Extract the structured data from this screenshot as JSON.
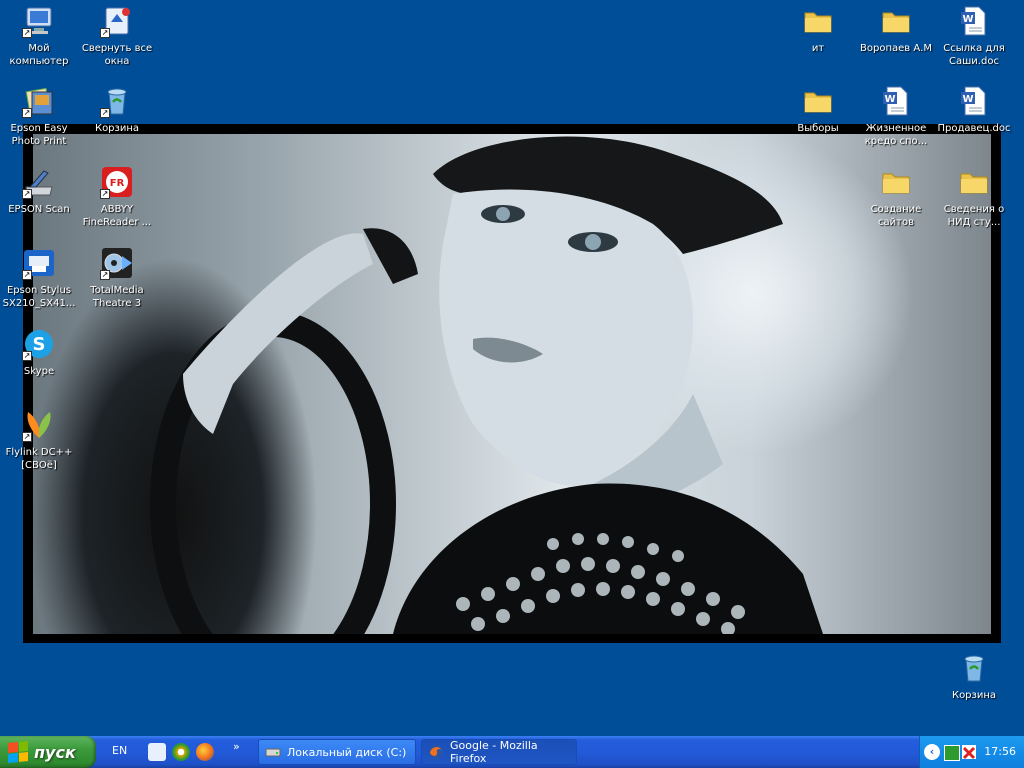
{
  "desktop_icons_left": [
    {
      "label": "Мой компьютер",
      "icon": "my-computer-icon"
    },
    {
      "label": "Свернуть все окна",
      "icon": "show-desktop-icon"
    },
    {
      "label": "Epson Easy Photo Print",
      "icon": "epson-easy-photo-print-icon"
    },
    {
      "label": "Корзина",
      "icon": "recycle-bin-icon"
    },
    {
      "label": "EPSON Scan",
      "icon": "epson-scan-icon"
    },
    {
      "label": "ABBYY FineReader ...",
      "icon": "abbyy-finereader-icon"
    },
    {
      "label": "Epson Stylus SX210_SX41...",
      "icon": "epson-stylus-icon"
    },
    {
      "label": "TotalMedia Theatre 3",
      "icon": "totalmedia-theatre-icon"
    },
    {
      "label": "Skype",
      "icon": "skype-icon"
    },
    {
      "label": "Flylink DC++ [СВОё]",
      "icon": "flylink-icon"
    }
  ],
  "desktop_icons_right": [
    {
      "label": "ит",
      "icon": "folder-icon"
    },
    {
      "label": "Воропаев А.М",
      "icon": "folder-icon"
    },
    {
      "label": "Ссылка для Саши.doc",
      "icon": "word-document-icon"
    },
    {
      "label": "Выборы",
      "icon": "folder-icon"
    },
    {
      "label": "Жизненное кредо спо...",
      "icon": "word-document-icon"
    },
    {
      "label": "Продавец.doc",
      "icon": "word-document-icon"
    },
    {
      "label": "Создание сайтов",
      "icon": "folder-icon"
    },
    {
      "label": "Сведения о НИД сту...",
      "icon": "folder-icon"
    },
    {
      "label": "Корзина",
      "icon": "recycle-bin-icon"
    }
  ],
  "taskbar": {
    "start_label": "пуск",
    "language": "EN",
    "quick_launch_overflow": "»",
    "tasks": [
      {
        "label": "Локальный диск (C:)",
        "icon": "drive-icon"
      },
      {
        "label": "Google - Mozilla Firefox",
        "icon": "firefox-icon"
      }
    ],
    "clock": "17:56"
  },
  "colors": {
    "desktop_bg": "#004e98",
    "taskbar_blue": "#245edc",
    "start_green": "#3c9b3c",
    "tray_blue": "#138ce8"
  }
}
